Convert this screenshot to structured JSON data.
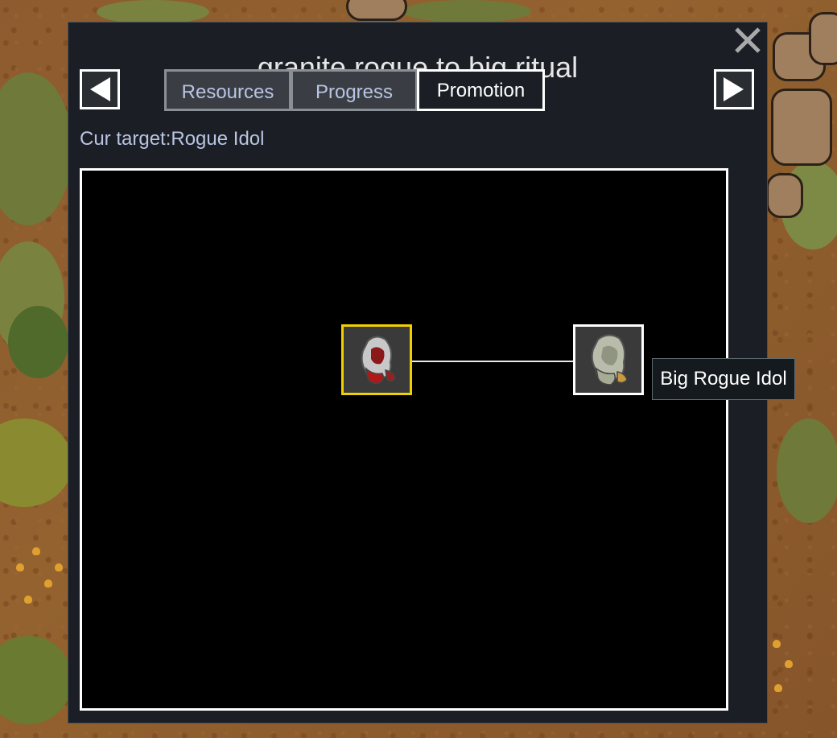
{
  "window": {
    "title": "granite rogue to big ritual",
    "close_icon": "close-x-icon"
  },
  "nav": {
    "prev_icon": "arrow-left-icon",
    "next_icon": "arrow-right-icon"
  },
  "tabs": [
    {
      "label": "Resources",
      "selected": false
    },
    {
      "label": "Progress",
      "selected": false
    },
    {
      "label": "Promotion",
      "selected": true
    }
  ],
  "cur_target": "Cur target:Rogue Idol",
  "tree": {
    "nodes": [
      {
        "id": "rogue-idol",
        "icon": "rogue-idol-icon",
        "highlight_color": "#f0d000",
        "current": true
      },
      {
        "id": "big-rogue-idol",
        "icon": "big-rogue-idol-icon",
        "highlight_color": "#ffffff",
        "current": false
      }
    ]
  },
  "tooltip": "Big Rogue Idol"
}
